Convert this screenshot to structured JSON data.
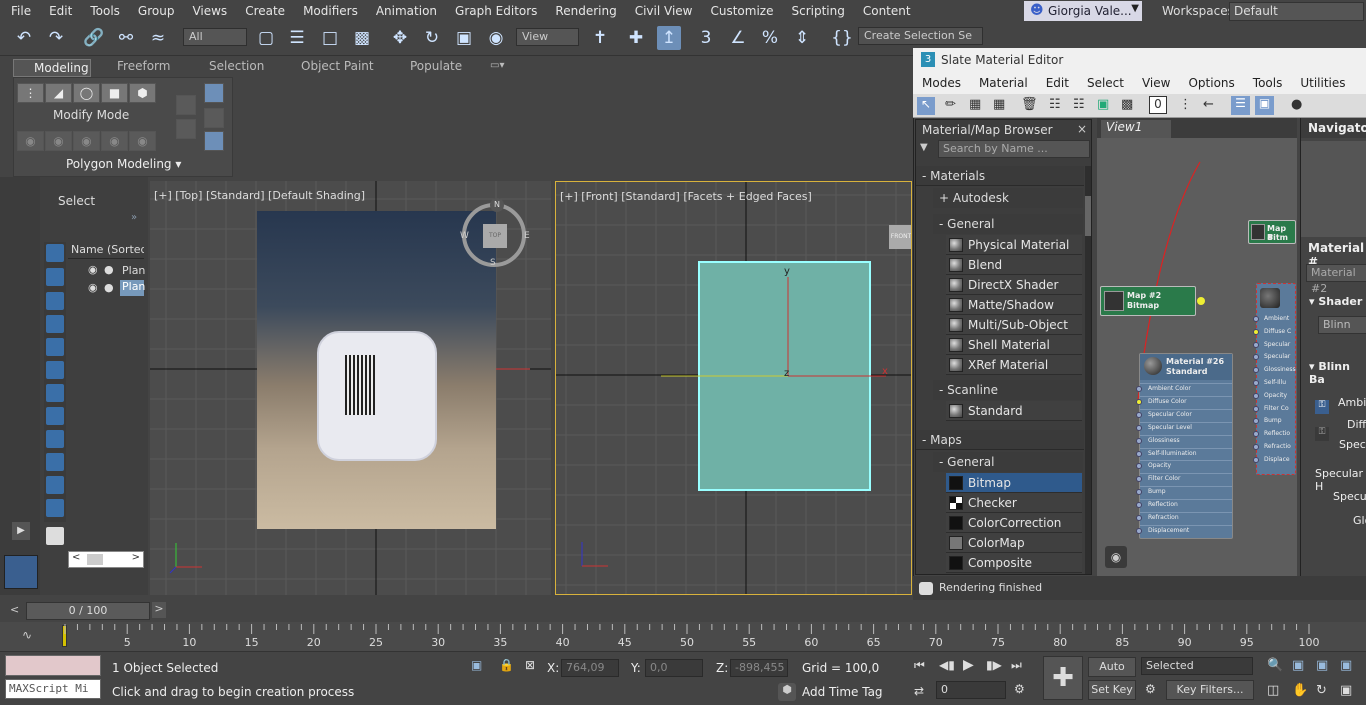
{
  "menu": [
    "File",
    "Edit",
    "Tools",
    "Group",
    "Views",
    "Create",
    "Modifiers",
    "Animation",
    "Graph Editors",
    "Rendering",
    "Civil View",
    "Customize",
    "Scripting",
    "Content"
  ],
  "user": {
    "name": "Giorgia Vale...",
    "workspaces_label": "Workspaces:",
    "workspace": "Default"
  },
  "toolbar": {
    "filter": "All",
    "coord": "View",
    "selection_set": "Create Selection Se"
  },
  "ribbon": {
    "tabs": [
      "Modeling",
      "Freeform",
      "Selection",
      "Object Paint",
      "Populate"
    ],
    "modify_mode": "Modify Mode",
    "polygon_modeling": "Polygon Modeling"
  },
  "scene": {
    "select_label": "Select",
    "column": "Name (Sorted A",
    "items": [
      "Plan",
      "Plan"
    ]
  },
  "viewport_top": {
    "label": "[+] [Top] [Standard] [Default Shading]",
    "compass": {
      "n": "N",
      "s": "S",
      "e": "E",
      "w": "W",
      "cube": "TOP"
    }
  },
  "viewport_front": {
    "label": "[+] [Front] [Standard] [Facets + Edged Faces]",
    "cube": "FRONT",
    "axis_y": "y",
    "axis_x": "x",
    "axis_z": "z"
  },
  "slate": {
    "title": "Slate Material Editor",
    "menu": [
      "Modes",
      "Material",
      "Edit",
      "Select",
      "View",
      "Options",
      "Tools",
      "Utilities"
    ],
    "browser_title": "Material/Map Browser",
    "search_placeholder": "Search by Name ...",
    "view_tab": "View1",
    "navigator": "Navigator",
    "materials_header": "- Materials",
    "autodesk": "+ Autodesk",
    "general_header": "- General",
    "general_items": [
      "Physical Material",
      "Blend",
      "DirectX Shader",
      "Matte/Shadow",
      "Multi/Sub-Object",
      "Shell Material",
      "XRef Material"
    ],
    "scanline_header": "- Scanline",
    "scanline_items": [
      "Standard"
    ],
    "maps_header": "- Maps",
    "maps_general_header": "- General",
    "maps_items": [
      "Bitmap",
      "Checker",
      "ColorCorrection",
      "ColorMap",
      "Composite"
    ],
    "status": "Rendering finished",
    "node_map": {
      "title": "Map #2",
      "sub": "Bitmap"
    },
    "node_map_small": {
      "title": "Map #",
      "sub": "Bitm"
    },
    "node_mat": {
      "title": "Material #26",
      "sub": "Standard",
      "slots": [
        "Ambient Color",
        "Diffuse Color",
        "Specular Color",
        "Specular Level",
        "Glossiness",
        "Self-Illumination",
        "Opacity",
        "Filter Color",
        "Bump",
        "Reflection",
        "Refraction",
        "Displacement"
      ]
    },
    "node_right_slots": [
      "Ambient",
      "Diffuse C",
      "Specular",
      "Specular",
      "Glossiness",
      "Self-Illu",
      "Opacity",
      "Filter Co",
      "Bump",
      "Reflectio",
      "Refractio",
      "Displace"
    ],
    "props": {
      "material": "Material #",
      "material_field": "Material #2",
      "shader": "Shader",
      "shader_value": "Blinn",
      "blinn": "Blinn Ba",
      "ambient": "Ambie",
      "diffuse": "Diffu",
      "specular": "Specul",
      "spec_high": "Specular H",
      "spec_level": "Specula",
      "gloss": "Glo"
    }
  },
  "time": {
    "frame": "0 / 100",
    "ticks": [
      "5",
      "10",
      "15",
      "20",
      "25",
      "30",
      "35",
      "40",
      "45",
      "50",
      "55",
      "60",
      "65",
      "70",
      "75",
      "80",
      "85",
      "90",
      "95",
      "100"
    ]
  },
  "bottom": {
    "maxscript": "MAXScript Mi",
    "selected": "1 Object Selected",
    "hint": "Click and drag to begin creation process",
    "x_label": "X:",
    "x": "764,09",
    "y_label": "Y:",
    "y": "0,0",
    "z_label": "Z:",
    "z": "-898,455",
    "grid": "Grid = 100,0",
    "add_time_tag": "Add Time Tag",
    "auto_key": "Auto Key",
    "set_key": "Set Key",
    "key_mode": "Selected",
    "key_filters": "Key Filters...",
    "frame": "0"
  }
}
